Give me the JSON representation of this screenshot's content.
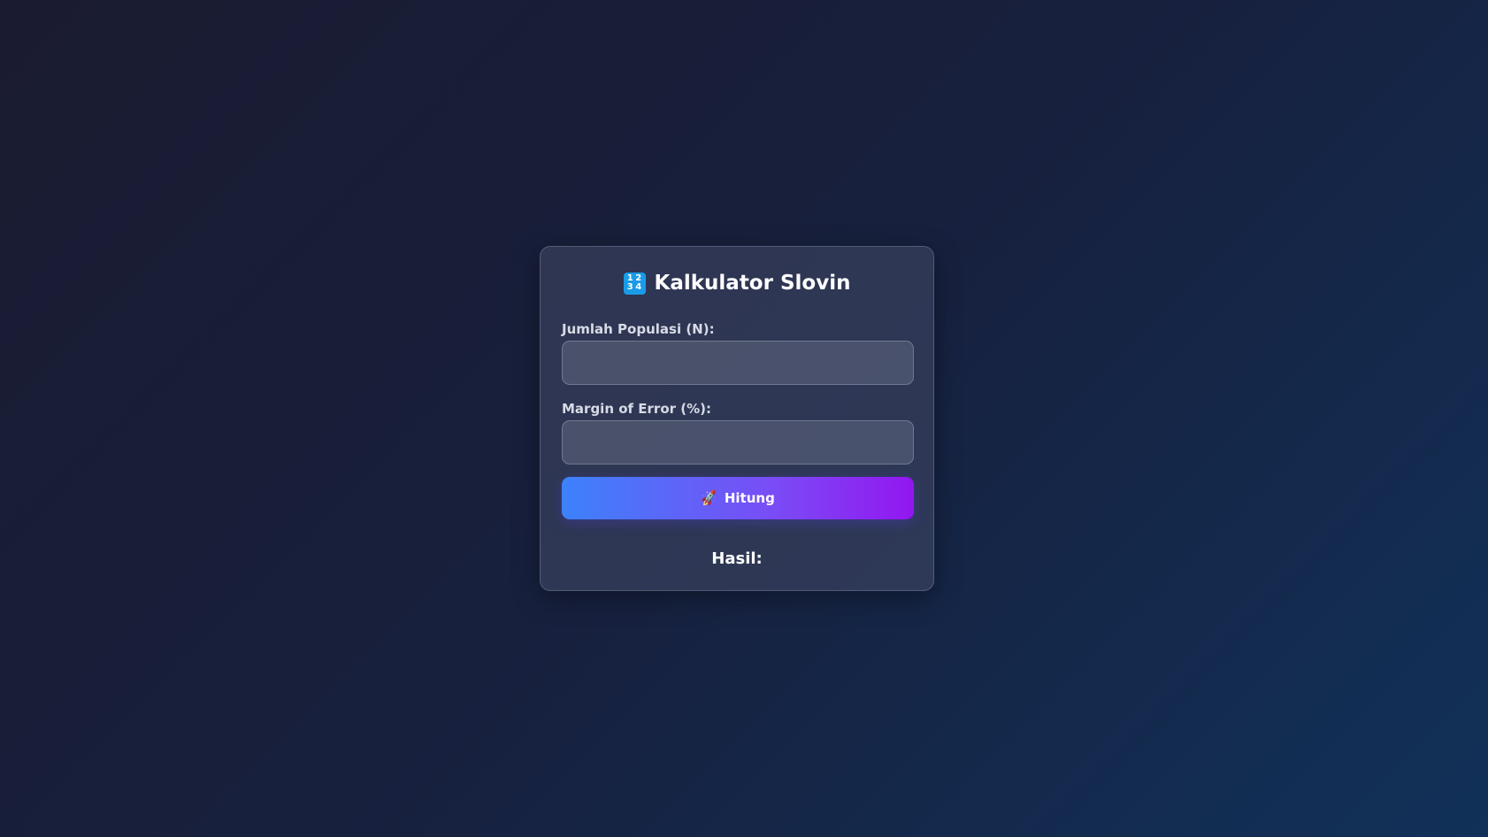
{
  "header": {
    "icon": "numbers-keycap-icon",
    "icon_digits": [
      "1",
      "2",
      "3",
      "4"
    ],
    "title": "Kalkulator Slovin"
  },
  "form": {
    "population": {
      "label": "Jumlah Populasi (N):",
      "value": "",
      "placeholder": ""
    },
    "margin_error": {
      "label": "Margin of Error (%):",
      "value": "",
      "placeholder": ""
    },
    "submit": {
      "icon": "rocket-icon",
      "label": "Hitung"
    }
  },
  "result": {
    "label": "Hasil:"
  },
  "colors": {
    "background_start": "#1a1b30",
    "background_end": "#113159",
    "button_gradient_start": "#3c82fc",
    "button_gradient_end": "#9316f0",
    "icon_blue": "#1a9be8"
  }
}
